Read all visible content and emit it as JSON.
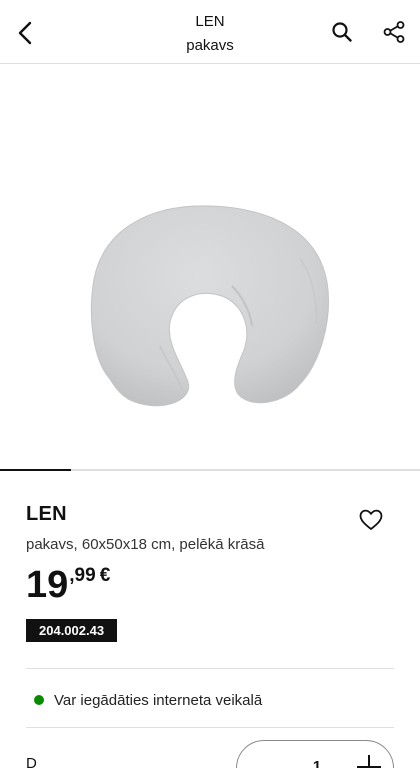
{
  "header": {
    "title": "LEN",
    "subtitle": "pakavs",
    "icons": {
      "back": "chevron-left-icon",
      "search": "search-icon",
      "share": "share-icon"
    }
  },
  "gallery": {
    "image": "grey-nursing-pillow",
    "progress": 0.17
  },
  "product": {
    "name": "LEN",
    "description": "pakavs, 60x50x18 cm, pelēkā krāsā",
    "price_integer": "19",
    "price_decimal": ",99",
    "currency": "€",
    "article_number": "204.002.43",
    "favorite_icon": "heart-icon"
  },
  "availability": {
    "text": "Var iegādāties interneta veikalā",
    "status_color": "#0a8a00"
  },
  "quantity": {
    "label": "D",
    "value": "1"
  },
  "colors": {
    "text": "#111111",
    "divider": "#dfdfdf",
    "pillow": "#d0d1d2"
  }
}
